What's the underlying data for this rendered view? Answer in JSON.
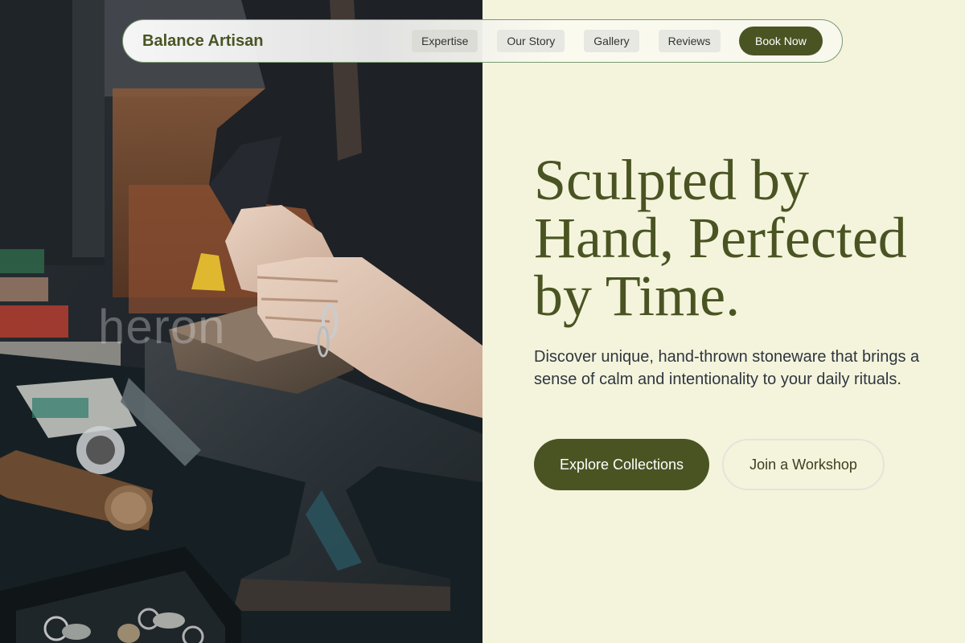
{
  "nav": {
    "brand": "Balance Artisan",
    "links": [
      {
        "label": "Expertise"
      },
      {
        "label": "Our Story"
      },
      {
        "label": "Gallery"
      },
      {
        "label": "Reviews"
      }
    ],
    "cta": "Book Now"
  },
  "hero": {
    "headline": "Sculpted by Hand, Perfected by Time.",
    "subheadline": "Discover unique, hand-thrown stoneware that brings a sense of calm and intentionality to your daily rituals.",
    "primary_button": "Explore Collections",
    "secondary_button": "Join a Workshop"
  },
  "image": {
    "watermark": "heron"
  },
  "colors": {
    "brand": "#4a5423",
    "background": "#f4f4dc",
    "body_text": "#2f3640"
  }
}
